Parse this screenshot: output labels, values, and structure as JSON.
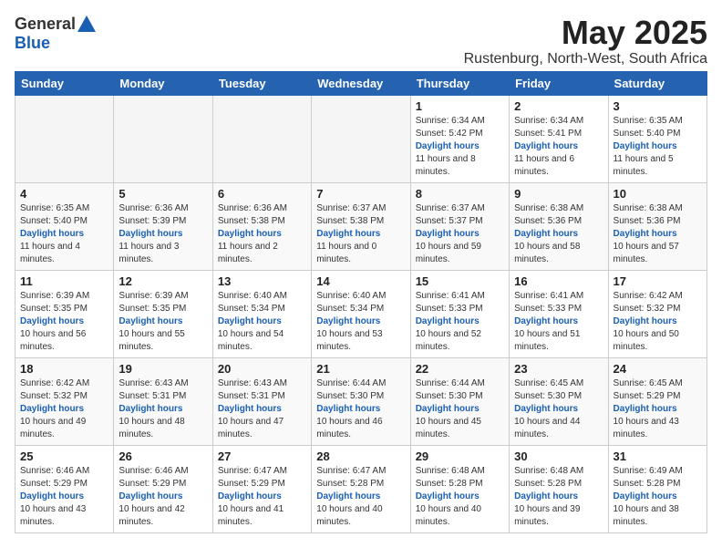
{
  "header": {
    "logo_general": "General",
    "logo_blue": "Blue",
    "month": "May 2025",
    "location": "Rustenburg, North-West, South Africa"
  },
  "days_of_week": [
    "Sunday",
    "Monday",
    "Tuesday",
    "Wednesday",
    "Thursday",
    "Friday",
    "Saturday"
  ],
  "weeks": [
    [
      {
        "day": "",
        "empty": true
      },
      {
        "day": "",
        "empty": true
      },
      {
        "day": "",
        "empty": true
      },
      {
        "day": "",
        "empty": true
      },
      {
        "day": "1",
        "sunrise": "6:34 AM",
        "sunset": "5:42 PM",
        "daylight": "11 hours and 8 minutes."
      },
      {
        "day": "2",
        "sunrise": "6:34 AM",
        "sunset": "5:41 PM",
        "daylight": "11 hours and 6 minutes."
      },
      {
        "day": "3",
        "sunrise": "6:35 AM",
        "sunset": "5:40 PM",
        "daylight": "11 hours and 5 minutes."
      }
    ],
    [
      {
        "day": "4",
        "sunrise": "6:35 AM",
        "sunset": "5:40 PM",
        "daylight": "11 hours and 4 minutes."
      },
      {
        "day": "5",
        "sunrise": "6:36 AM",
        "sunset": "5:39 PM",
        "daylight": "11 hours and 3 minutes."
      },
      {
        "day": "6",
        "sunrise": "6:36 AM",
        "sunset": "5:38 PM",
        "daylight": "11 hours and 2 minutes."
      },
      {
        "day": "7",
        "sunrise": "6:37 AM",
        "sunset": "5:38 PM",
        "daylight": "11 hours and 0 minutes."
      },
      {
        "day": "8",
        "sunrise": "6:37 AM",
        "sunset": "5:37 PM",
        "daylight": "10 hours and 59 minutes."
      },
      {
        "day": "9",
        "sunrise": "6:38 AM",
        "sunset": "5:36 PM",
        "daylight": "10 hours and 58 minutes."
      },
      {
        "day": "10",
        "sunrise": "6:38 AM",
        "sunset": "5:36 PM",
        "daylight": "10 hours and 57 minutes."
      }
    ],
    [
      {
        "day": "11",
        "sunrise": "6:39 AM",
        "sunset": "5:35 PM",
        "daylight": "10 hours and 56 minutes."
      },
      {
        "day": "12",
        "sunrise": "6:39 AM",
        "sunset": "5:35 PM",
        "daylight": "10 hours and 55 minutes."
      },
      {
        "day": "13",
        "sunrise": "6:40 AM",
        "sunset": "5:34 PM",
        "daylight": "10 hours and 54 minutes."
      },
      {
        "day": "14",
        "sunrise": "6:40 AM",
        "sunset": "5:34 PM",
        "daylight": "10 hours and 53 minutes."
      },
      {
        "day": "15",
        "sunrise": "6:41 AM",
        "sunset": "5:33 PM",
        "daylight": "10 hours and 52 minutes."
      },
      {
        "day": "16",
        "sunrise": "6:41 AM",
        "sunset": "5:33 PM",
        "daylight": "10 hours and 51 minutes."
      },
      {
        "day": "17",
        "sunrise": "6:42 AM",
        "sunset": "5:32 PM",
        "daylight": "10 hours and 50 minutes."
      }
    ],
    [
      {
        "day": "18",
        "sunrise": "6:42 AM",
        "sunset": "5:32 PM",
        "daylight": "10 hours and 49 minutes."
      },
      {
        "day": "19",
        "sunrise": "6:43 AM",
        "sunset": "5:31 PM",
        "daylight": "10 hours and 48 minutes."
      },
      {
        "day": "20",
        "sunrise": "6:43 AM",
        "sunset": "5:31 PM",
        "daylight": "10 hours and 47 minutes."
      },
      {
        "day": "21",
        "sunrise": "6:44 AM",
        "sunset": "5:30 PM",
        "daylight": "10 hours and 46 minutes."
      },
      {
        "day": "22",
        "sunrise": "6:44 AM",
        "sunset": "5:30 PM",
        "daylight": "10 hours and 45 minutes."
      },
      {
        "day": "23",
        "sunrise": "6:45 AM",
        "sunset": "5:30 PM",
        "daylight": "10 hours and 44 minutes."
      },
      {
        "day": "24",
        "sunrise": "6:45 AM",
        "sunset": "5:29 PM",
        "daylight": "10 hours and 43 minutes."
      }
    ],
    [
      {
        "day": "25",
        "sunrise": "6:46 AM",
        "sunset": "5:29 PM",
        "daylight": "10 hours and 43 minutes."
      },
      {
        "day": "26",
        "sunrise": "6:46 AM",
        "sunset": "5:29 PM",
        "daylight": "10 hours and 42 minutes."
      },
      {
        "day": "27",
        "sunrise": "6:47 AM",
        "sunset": "5:29 PM",
        "daylight": "10 hours and 41 minutes."
      },
      {
        "day": "28",
        "sunrise": "6:47 AM",
        "sunset": "5:28 PM",
        "daylight": "10 hours and 40 minutes."
      },
      {
        "day": "29",
        "sunrise": "6:48 AM",
        "sunset": "5:28 PM",
        "daylight": "10 hours and 40 minutes."
      },
      {
        "day": "30",
        "sunrise": "6:48 AM",
        "sunset": "5:28 PM",
        "daylight": "10 hours and 39 minutes."
      },
      {
        "day": "31",
        "sunrise": "6:49 AM",
        "sunset": "5:28 PM",
        "daylight": "10 hours and 38 minutes."
      }
    ]
  ],
  "labels": {
    "sunrise": "Sunrise:",
    "sunset": "Sunset:",
    "daylight": "Daylight hours"
  }
}
